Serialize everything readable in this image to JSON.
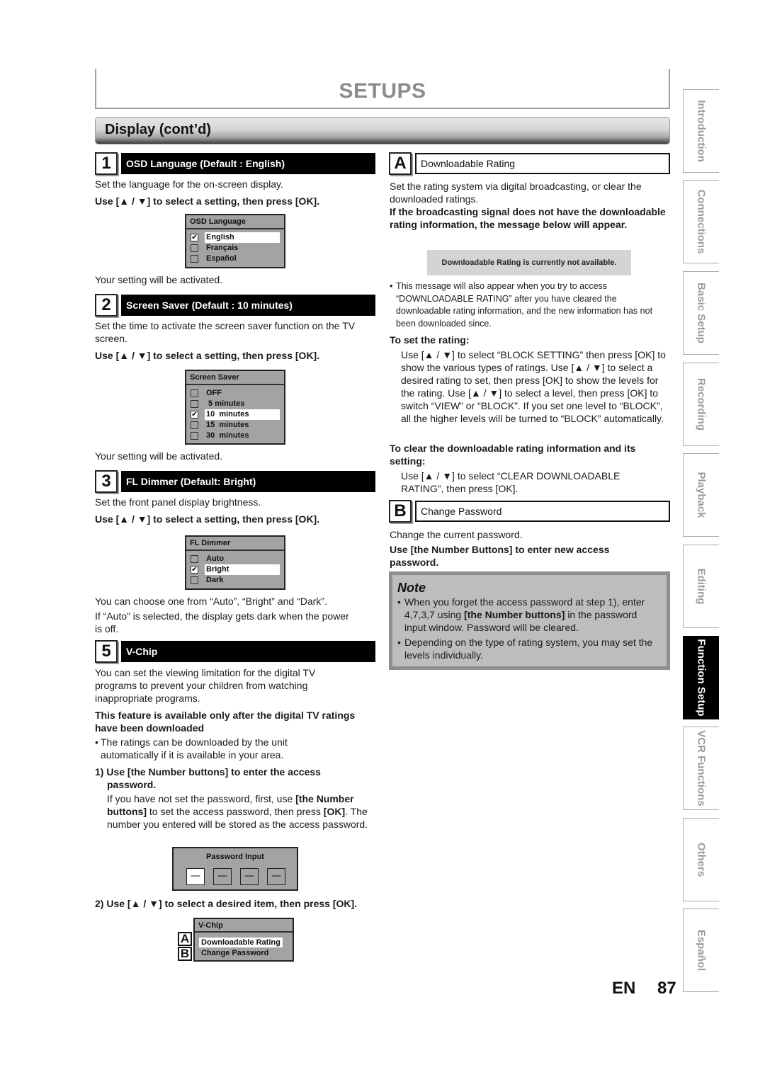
{
  "header": {
    "title": "SETUPS",
    "section": "Display (cont’d)"
  },
  "steps": [
    {
      "num": "1",
      "title": "OSD Language (Default : English)"
    },
    {
      "num": "2",
      "title": "Screen Saver (Default : 10 minutes)"
    },
    {
      "num": "3",
      "title": "FL Dimmer (Default: Bright)"
    },
    {
      "num": "5",
      "title": "V-Chip"
    }
  ],
  "step1": {
    "desc": "Set the language for the on-screen display.",
    "instruction": "Use [▲ / ▼] to select a setting, then press [OK].",
    "menu": {
      "title": "OSD Language",
      "options": [
        "English",
        "Français",
        "Español"
      ],
      "selected": "English"
    },
    "after": "Your setting will be activated."
  },
  "step2": {
    "desc": "Set the time to activate the screen saver function on the TV screen.",
    "instruction": "Use [▲ / ▼] to select a setting, then press [OK].",
    "menu": {
      "title": "Screen Saver",
      "options": [
        "OFF",
        " 5 minutes",
        "10  minutes",
        "15  minutes",
        "30  minutes"
      ],
      "selected": "10  minutes"
    },
    "after": "Your setting will be activated."
  },
  "step3": {
    "desc": "Set the front panel display brightness.",
    "instruction": "Use [▲ / ▼] to select a setting, then press [OK].",
    "menu": {
      "title": "FL Dimmer",
      "options": [
        "Auto",
        "Bright",
        "Dark"
      ],
      "selected": "Bright"
    },
    "after1": "You can choose one from “Auto”, “Bright” and “Dark”.",
    "after2": "If “Auto” is selected, the display gets dark when the power is off."
  },
  "step5": {
    "desc": "You can set the viewing limitation for the digital TV programs to prevent your children from watching inappropriate programs.",
    "bold_notice": "This feature is available only after the digital TV ratings have been downloaded",
    "bullet": "The ratings can be downloaded by the unit automatically if it is available in your area.",
    "sub1_title": "1) Use [the Number buttons] to enter the access password.",
    "sub1_body_a": "If you have not set the password, first, use ",
    "sub1_body_b": "[the Number buttons]",
    "sub1_body_c": " to set the access password, then press ",
    "sub1_body_d": "[OK]",
    "sub1_body_e": ". The number you entered will be stored as the access password.",
    "password_box": {
      "title": "Password Input",
      "slots": [
        "—",
        "—",
        "—",
        "—"
      ]
    },
    "sub2_title": "2) Use [▲ / ▼] to select a desired item, then press [OK].",
    "vchip_menu": {
      "title": "V-Chip",
      "items": [
        {
          "letter": "A",
          "label": "Downloadable Rating",
          "selected": true
        },
        {
          "letter": "B",
          "label": "Change Password",
          "selected": false
        }
      ]
    }
  },
  "subA": {
    "letter": "A",
    "title": "Downloadable Rating",
    "desc": "Set the rating system via digital broadcasting, or clear the downloaded ratings.",
    "bold": "If the broadcasting signal does not have the downloadable rating information, the message below will appear.",
    "message": "Downloadable Rating is currently not available.",
    "bullet": "This message will also appear when you try to access “DOWNLOADABLE RATING” after you have cleared the downloadable rating information, and the new information has not been downloaded since.",
    "set_title": "To set the rating:",
    "set_body": "Use [▲ / ▼] to select “BLOCK SETTING” then press [OK] to show the various types of ratings. Use [▲ / ▼] to select a desired rating to set, then press [OK] to show the levels for the rating. Use [▲ / ▼] to select a level, then press [OK] to switch “VIEW” or “BLOCK”. If you set one level to “BLOCK”, all the higher levels will be turned to “BLOCK” automatically.",
    "clear_title": "To clear the downloadable rating information and its setting:",
    "clear_body": "Use [▲ / ▼] to select “CLEAR DOWNLOADABLE RATING”, then press [OK]."
  },
  "subB": {
    "letter": "B",
    "title": "Change Password",
    "desc": "Change the current password.",
    "bold": "Use [the Number Buttons] to enter new access password."
  },
  "note": {
    "title": "Note",
    "items": [
      {
        "a": "When you forget the access password at step 1), enter 4,7,3,7 using ",
        "b": "[the Number buttons]",
        "c": " in the password input window. Password will be cleared."
      },
      {
        "a": "Depending on the type of rating system, you may set the levels individually.",
        "b": "",
        "c": ""
      }
    ]
  },
  "side_tabs": [
    {
      "label": "Introduction",
      "active": false
    },
    {
      "label": "Connections",
      "active": false
    },
    {
      "label": "Basic Setup",
      "active": false
    },
    {
      "label": "Recording",
      "active": false
    },
    {
      "label": "Playback",
      "active": false
    },
    {
      "label": "Editing",
      "active": false
    },
    {
      "label": "Function Setup",
      "active": true
    },
    {
      "label": "VCR Functions",
      "active": false
    },
    {
      "label": "Others",
      "active": false
    },
    {
      "label": "Español",
      "active": false
    }
  ],
  "footer": {
    "lang": "EN",
    "page": "87"
  }
}
